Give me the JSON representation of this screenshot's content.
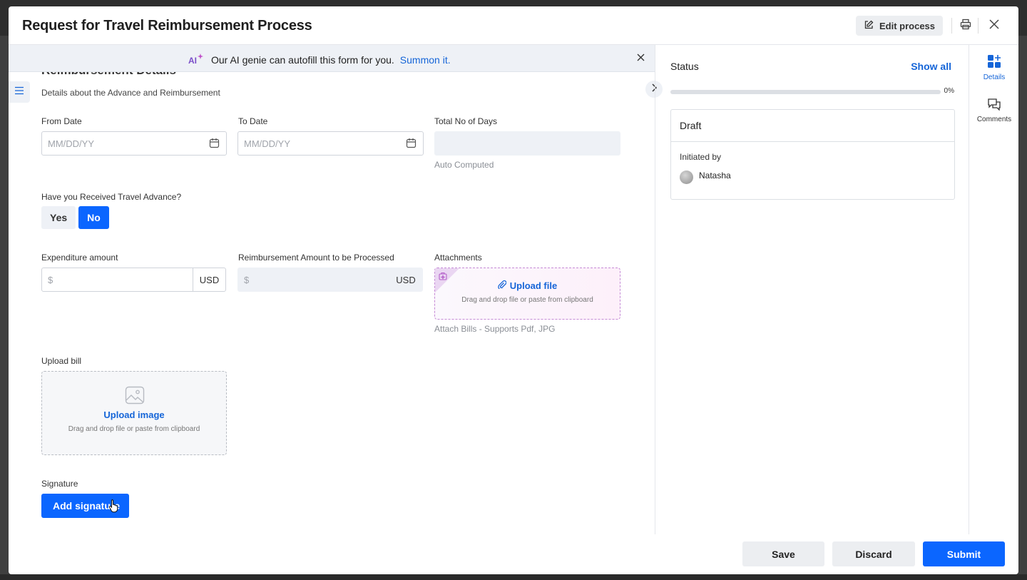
{
  "modal": {
    "title": "Request for Travel Reimbursement Process",
    "edit_label": "Edit process"
  },
  "ai_banner": {
    "badge": "AI",
    "message": "Our AI genie can autofill this form for you.",
    "link": "Summon it."
  },
  "section": {
    "title": "Reimbursement Details",
    "subtitle": "Details about the Advance and Reimbursement"
  },
  "fields": {
    "from_date": {
      "label": "From Date",
      "placeholder": "MM/DD/YY"
    },
    "to_date": {
      "label": "To Date",
      "placeholder": "MM/DD/YY"
    },
    "total_days": {
      "label": "Total No of Days",
      "hint": "Auto Computed"
    },
    "advance": {
      "label": "Have you Received Travel Advance?",
      "yes": "Yes",
      "no": "No",
      "selected": "No"
    },
    "expenditure": {
      "label": "Expenditure amount",
      "symbol": "$",
      "currency": "USD"
    },
    "reimbursement": {
      "label": "Reimbursement Amount to be Processed",
      "symbol": "$",
      "currency": "USD"
    },
    "attachments": {
      "label": "Attachments",
      "upload": "Upload file",
      "drop": "Drag and drop file or paste from clipboard",
      "hint": "Attach Bills - Supports Pdf, JPG"
    },
    "upload_bill": {
      "label": "Upload bill",
      "upload": "Upload image",
      "drop": "Drag and drop file or paste from clipboard"
    },
    "signature": {
      "label": "Signature",
      "button": "Add signature"
    }
  },
  "status_panel": {
    "title": "Status",
    "show_all": "Show all",
    "progress": 0,
    "progress_text": "0%",
    "state": "Draft",
    "initiated_label": "Initiated by",
    "initiator": "Natasha"
  },
  "rail": {
    "details": "Details",
    "comments": "Comments"
  },
  "footer": {
    "save": "Save",
    "discard": "Discard",
    "submit": "Submit"
  },
  "colors": {
    "primary": "#0b66ff",
    "link": "#1565d8",
    "muted_bg": "#eef1f6"
  }
}
